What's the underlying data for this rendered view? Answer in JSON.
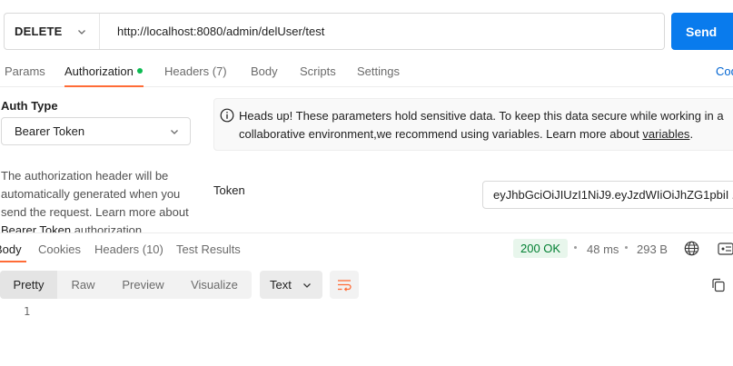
{
  "request": {
    "method": "DELETE",
    "url": "http://localhost:8080/admin/delUser/test",
    "send_label": "Send"
  },
  "request_tabs": [
    {
      "label": "Params"
    },
    {
      "label": "Authorization"
    },
    {
      "label": "Headers (7)"
    },
    {
      "label": "Body"
    },
    {
      "label": "Scripts"
    },
    {
      "label": "Settings"
    }
  ],
  "code_label": "Cod",
  "auth": {
    "type_label": "Auth Type",
    "type_value": "Bearer Token",
    "description_part1": "The authorization header will be automatically generated when you send the request. Learn more about ",
    "description_highlight": "Bearer Token",
    "description_part2": " authorization.",
    "heads_up_text": "Heads up! These parameters hold sensitive data. To keep this data secure while working in a collaborative environment,we recommend using variables. Learn more about ",
    "heads_up_link": "variables",
    "heads_up_end": ".",
    "token_label": "Token",
    "token_value": "eyJhbGciOiJIUzI1NiJ9.eyJzdWIiOiJhZG1pbiI",
    "token_ellipsis": "..."
  },
  "response_tabs": [
    {
      "label": "Body"
    },
    {
      "label": "Cookies"
    },
    {
      "label": "Headers (10)"
    },
    {
      "label": "Test Results"
    }
  ],
  "response_meta": {
    "status": "200 OK",
    "time": "48 ms",
    "size": "293 B",
    "status_color": "#007f31"
  },
  "view_modes": [
    {
      "label": "Pretty"
    },
    {
      "label": "Raw"
    },
    {
      "label": "Preview"
    },
    {
      "label": "Visualize"
    }
  ],
  "format": "Text",
  "body_lines": [
    "1"
  ],
  "colors": {
    "accent": "#ff6c37",
    "send_button": "#097bed",
    "link": "#0265d2"
  }
}
